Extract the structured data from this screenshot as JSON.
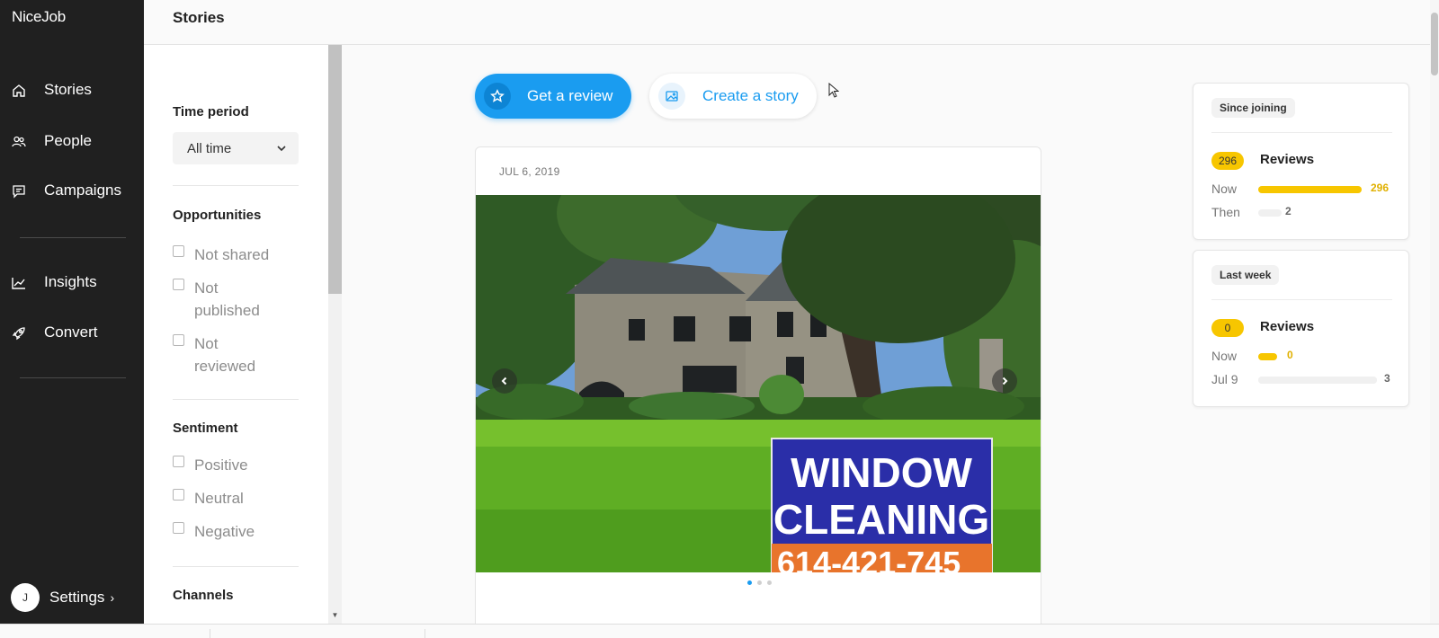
{
  "sidebar": {
    "brand": "NiceJob",
    "items": [
      {
        "label": "Stories",
        "icon": "home-icon"
      },
      {
        "label": "People",
        "icon": "people-icon"
      },
      {
        "label": "Campaigns",
        "icon": "chat-icon"
      },
      {
        "label": "Insights",
        "icon": "chart-line-icon"
      },
      {
        "label": "Convert",
        "icon": "rocket-icon"
      }
    ],
    "settings": {
      "avatar_initial": "J",
      "label": "Settings",
      "chevron": "›"
    }
  },
  "header": {
    "title": "Stories"
  },
  "filters": {
    "time_period": {
      "heading": "Time period",
      "selected": "All time"
    },
    "opportunities": {
      "heading": "Opportunities",
      "options": [
        "Not shared",
        "Not published",
        "Not reviewed"
      ]
    },
    "sentiment": {
      "heading": "Sentiment",
      "options": [
        "Positive",
        "Neutral",
        "Negative"
      ]
    },
    "channels": {
      "heading": "Channels"
    }
  },
  "actions": {
    "get_review": "Get a review",
    "create_story": "Create a story"
  },
  "story": {
    "date": "JUL 6, 2019",
    "sign_line1": "WINDOW",
    "sign_line2": "CLEANING",
    "sign_phone": "614-421-745",
    "dots": 3,
    "active_dot": 0
  },
  "stats": {
    "since_joining": {
      "chip": "Since joining",
      "count": "296",
      "title": "Reviews",
      "rows": [
        {
          "label": "Now",
          "value": "296",
          "fraction": 0.87
        },
        {
          "label": "Then",
          "value": "2",
          "fraction": 0.2
        }
      ]
    },
    "last_week": {
      "chip": "Last week",
      "count": "0",
      "title": "Reviews",
      "rows": [
        {
          "label": "Now",
          "value": "0",
          "fraction": 0.16
        },
        {
          "label": "Jul 9",
          "value": "3",
          "fraction": 1.0
        }
      ]
    }
  },
  "colors": {
    "accent": "#1a9cf0",
    "yellow": "#f7c600",
    "sidebar": "#202020"
  }
}
